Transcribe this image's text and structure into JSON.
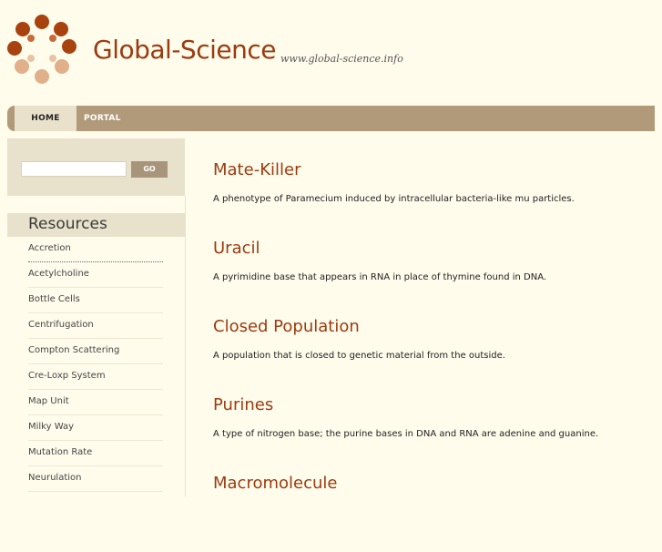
{
  "header": {
    "site_title": "Global-Science",
    "site_url": "www.global-science.info",
    "logo_icon": "flower-logo-icon",
    "colors": {
      "brand": "#9b3b10",
      "logo_dark": "#a8420e",
      "logo_light": "#e0b08a"
    }
  },
  "nav": {
    "tabs": [
      {
        "label": "HOME"
      },
      {
        "label": "PORTAL"
      }
    ]
  },
  "search": {
    "value": "",
    "go_label": "GO"
  },
  "sidebar": {
    "title": "Resources",
    "items": [
      {
        "label": "Accretion"
      },
      {
        "label": "Acetylcholine"
      },
      {
        "label": "Bottle Cells"
      },
      {
        "label": "Centrifugation"
      },
      {
        "label": "Compton Scattering"
      },
      {
        "label": "Cre-Loxp System"
      },
      {
        "label": "Map Unit"
      },
      {
        "label": "Milky Way"
      },
      {
        "label": "Mutation Rate"
      },
      {
        "label": "Neurulation"
      }
    ]
  },
  "main": {
    "entries": [
      {
        "title": "Mate-Killer",
        "desc": "A phenotype of Paramecium induced by intracellular bacteria-like mu particles."
      },
      {
        "title": "Uracil",
        "desc": "A pyrimidine base that appears in RNA in place of thymine found in DNA."
      },
      {
        "title": "Closed Population",
        "desc": "A population that is closed to genetic material from the outside."
      },
      {
        "title": "Purines",
        "desc": "A type of nitrogen base; the purine bases in DNA and RNA are adenine and guanine."
      },
      {
        "title": "Macromolecule",
        "desc": ""
      }
    ]
  }
}
